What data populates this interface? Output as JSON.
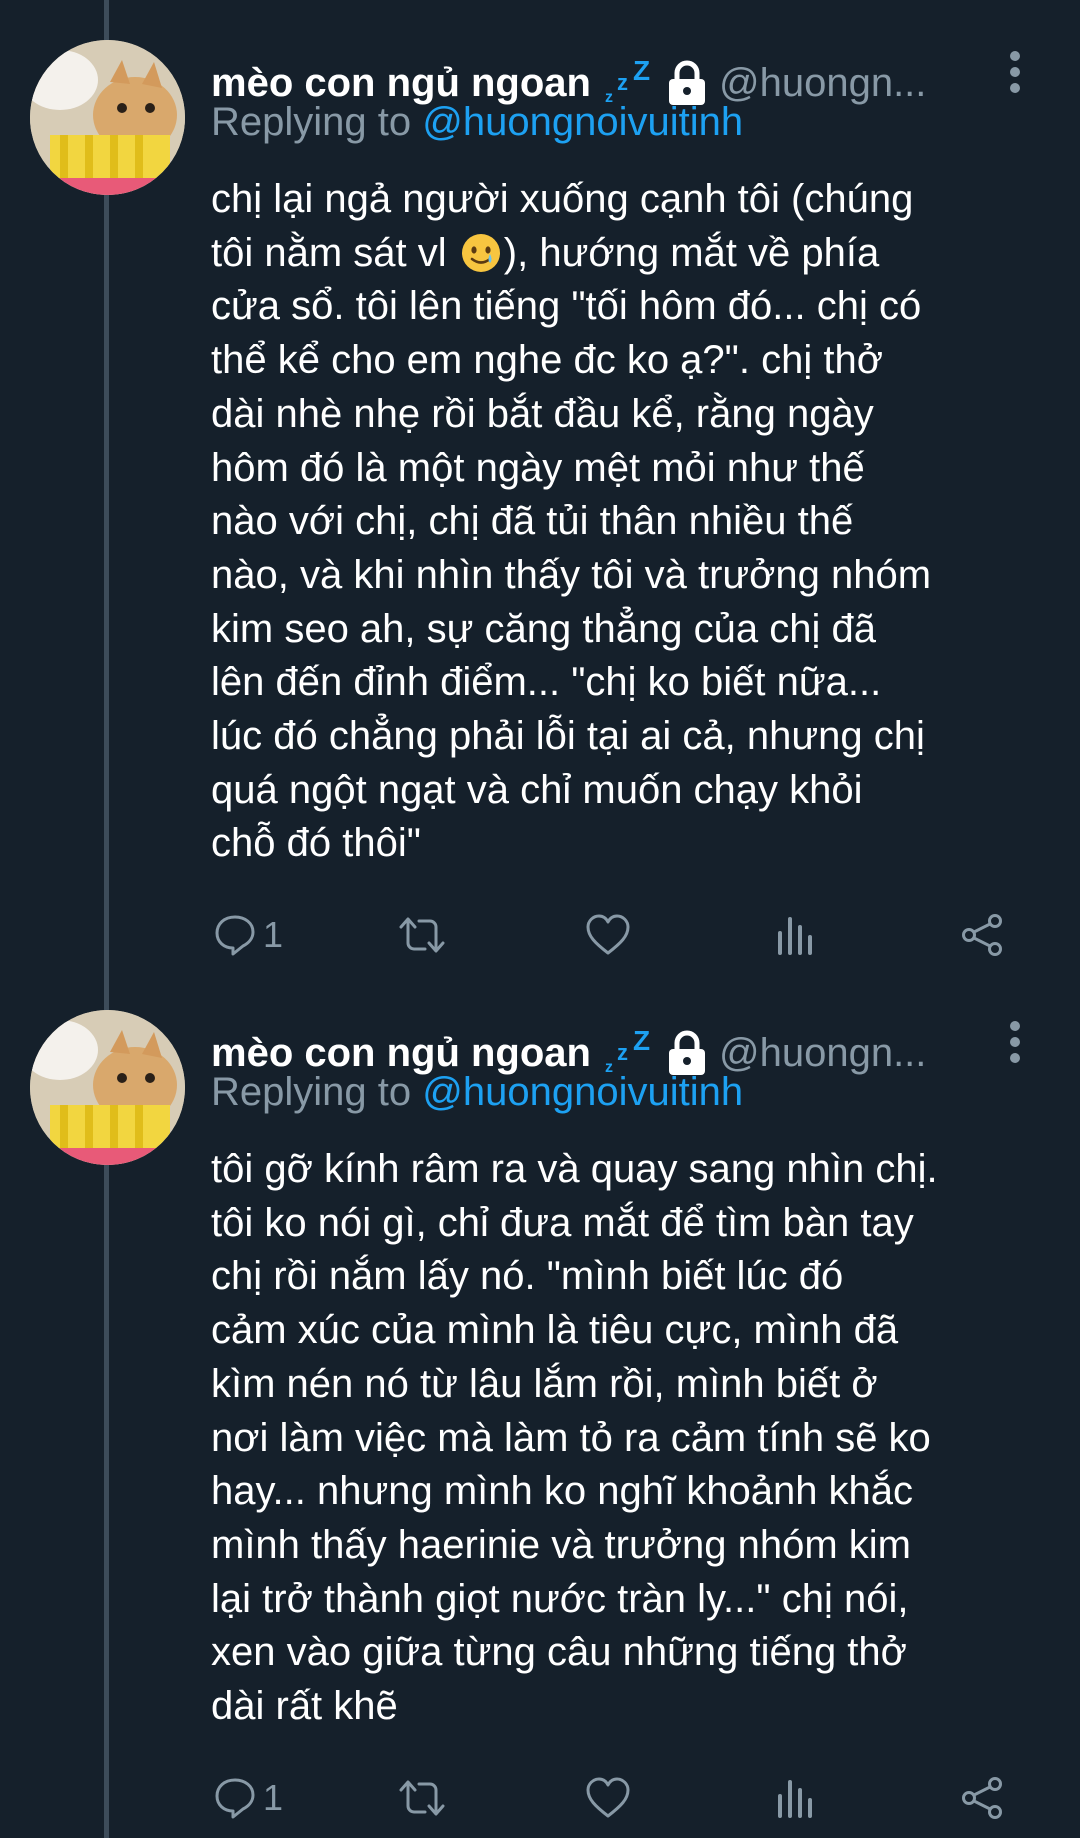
{
  "tweets": [
    {
      "display_name": "mèo con ngủ ngoan",
      "name_icons": [
        "zzz-icon",
        "lock-icon"
      ],
      "handle": "@huongn...",
      "replying_prefix": "Replying to",
      "replying_to": "@huongnoivuitinh",
      "lines": [
        "chị lại ngả người xuống cạnh tôi (chúng",
        "tôi nằm sát vl",
        "), hướng mắt về phía",
        "cửa sổ. tôi lên tiếng \"tối hôm đó... chị có",
        "thể kể cho em nghe đc ko ạ?\". chị thở",
        "dài nhè nhẹ rồi bắt đầu kể, rằng ngày",
        "hôm đó là một ngày mệt mỏi như thế",
        "nào với chị, chị đã tủi thân nhiều thế",
        "nào, và khi nhìn thấy tôi và trưởng nhóm",
        "kim seo ah, sự căng thẳng của chị đã",
        "lên đến đỉnh điểm... \"chị ko biết nữa...",
        "lúc đó chẳng phải lỗi tại ai cả, nhưng chị",
        "quá ngột ngạt và chỉ muốn chạy khỏi",
        "chỗ đó thôi\""
      ],
      "emoji": "smiling-face-with-tear-emoji",
      "reply_count": "1"
    },
    {
      "display_name": "mèo con ngủ ngoan",
      "name_icons": [
        "zzz-icon",
        "lock-icon"
      ],
      "handle": "@huongn...",
      "replying_prefix": "Replying to",
      "replying_to": "@huongnoivuitinh",
      "lines": [
        "tôi gỡ kính râm ra và quay sang nhìn chị.",
        "tôi ko nói gì, chỉ đưa mắt để tìm bàn tay",
        "chị rồi nắm lấy nó. \"mình biết lúc đó",
        "cảm xúc của mình là tiêu cực, mình đã",
        "kìm nén nó từ lâu lắm rồi, mình biết ở",
        "nơi làm việc mà làm tỏ ra cảm tính sẽ ko",
        "hay... nhưng mình ko nghĩ khoảnh khắc",
        "mình thấy haerinie và trưởng nhóm kim",
        "lại trở thành giọt nước tràn ly...\" chị nói,",
        "xen vào giữa từng câu những tiếng thở",
        "dài rất khẽ"
      ],
      "reply_count": "1"
    }
  ],
  "action_icons": [
    "reply-icon",
    "retweet-icon",
    "like-icon",
    "analytics-icon",
    "share-icon"
  ],
  "colors": {
    "background": "#15202b",
    "text": "#ffffff",
    "secondary": "#8899a6",
    "mention": "#1da1f2",
    "thread_line": "#3d4c5a"
  }
}
